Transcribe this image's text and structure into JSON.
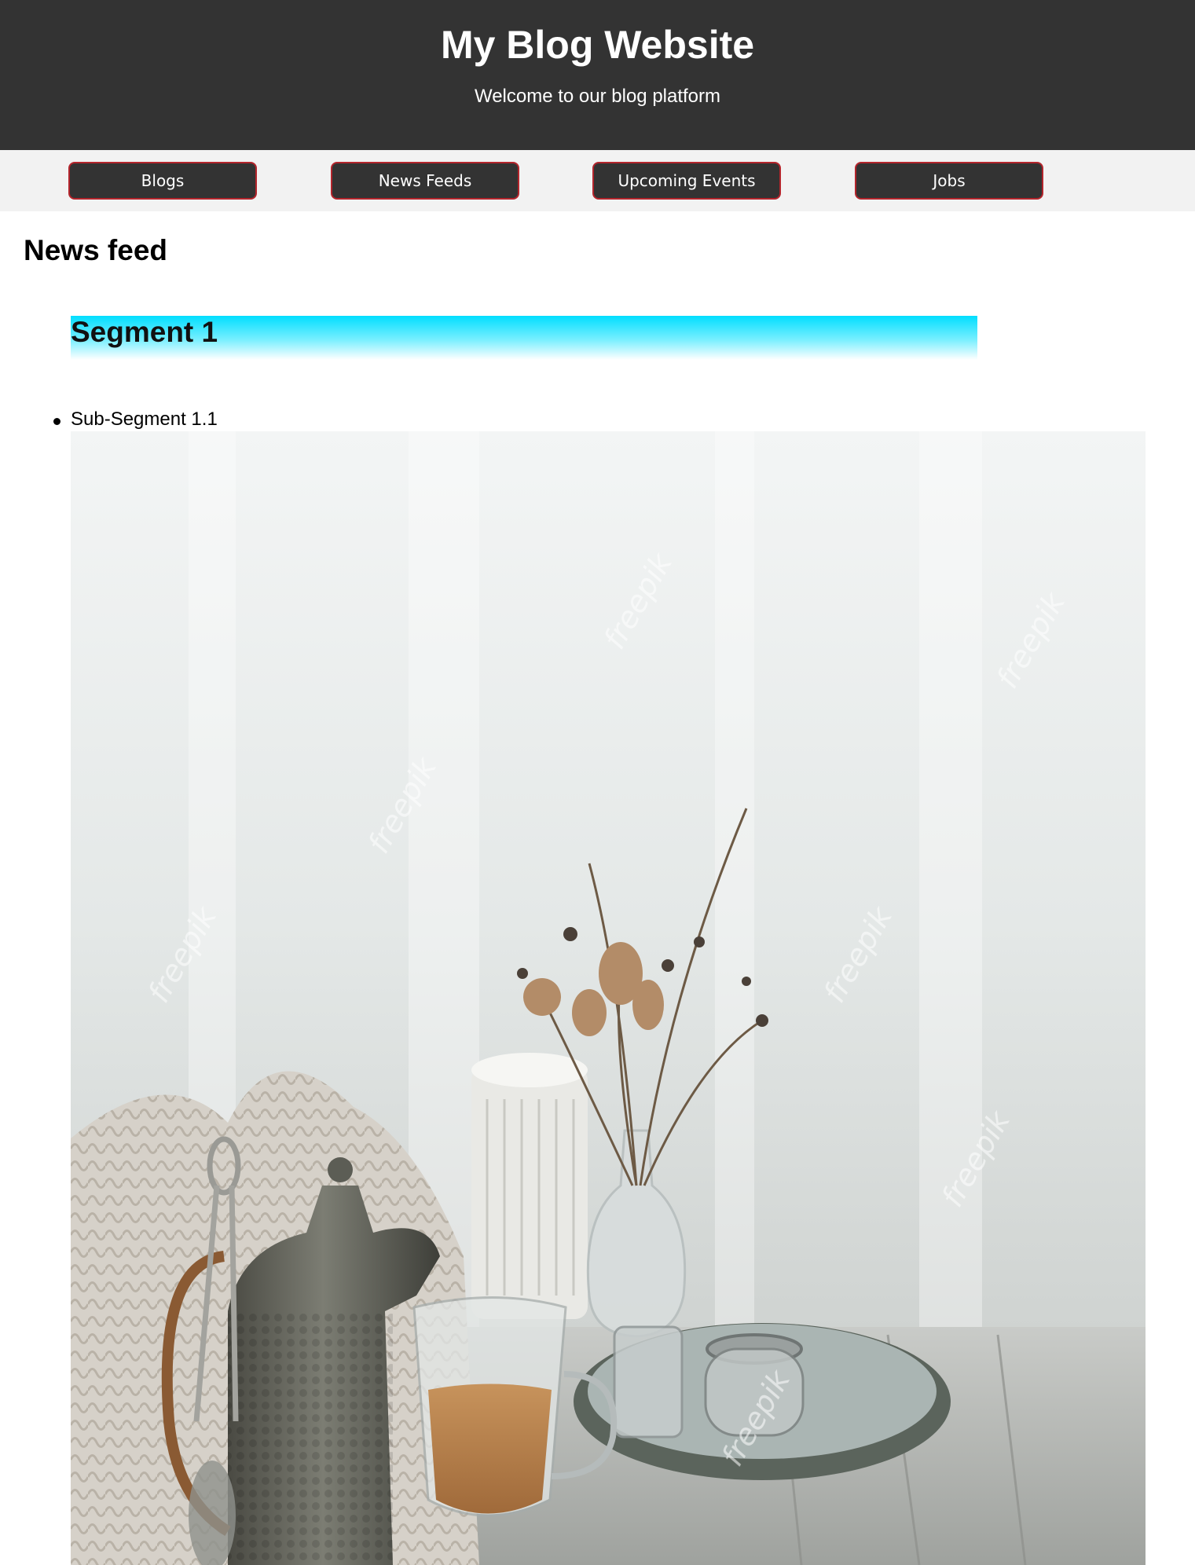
{
  "header": {
    "title": "My Blog Website",
    "tagline": "Welcome to our blog platform"
  },
  "nav": {
    "items": [
      {
        "label": "Blogs"
      },
      {
        "label": "News Feeds"
      },
      {
        "label": "Upcoming Events"
      },
      {
        "label": "Jobs"
      }
    ]
  },
  "main": {
    "section_title": "News feed",
    "segment": {
      "title": "Segment 1",
      "sub_segments": [
        {
          "label": "Sub-Segment 1.1"
        }
      ]
    },
    "image": {
      "alt": "Still life: teapot, tea glass, candle, dried flowers in vase, tray on wooden table",
      "watermark": "freepik"
    }
  },
  "colors": {
    "header_bg": "#333333",
    "nav_bg": "#f2f2f2",
    "nav_button_border": "#b3252c",
    "segment_gradient_top": "#00deff"
  }
}
